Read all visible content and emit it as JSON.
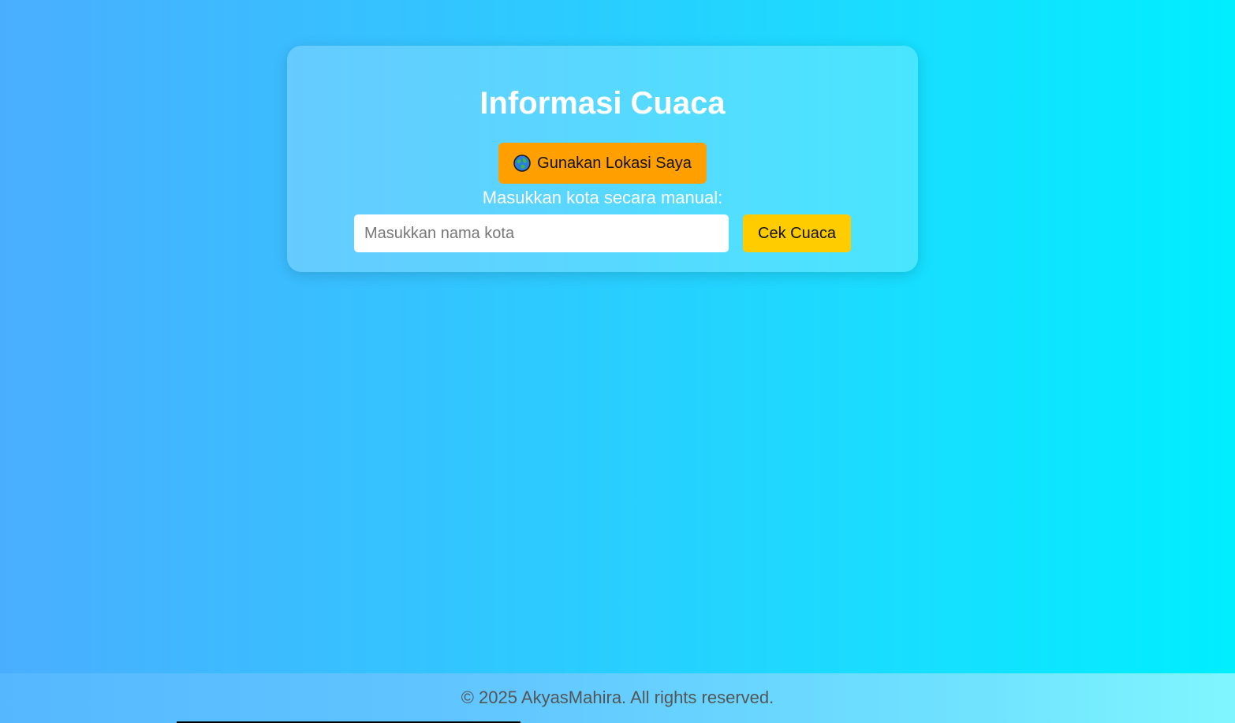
{
  "card": {
    "title": "Informasi Cuaca",
    "location_button": {
      "icon": "globe-icon",
      "label": "Gunakan Lokasi Saya"
    },
    "manual_label": "Masukkan kota secara manual:",
    "city_input": {
      "value": "",
      "placeholder": "Masukkan nama kota"
    },
    "check_button_label": "Cek Cuaca"
  },
  "footer": {
    "text": "© 2025 AkyasMahira. All rights reserved."
  },
  "colors": {
    "location_button": "#ff9f00",
    "check_button": "#ffcc00",
    "background_start": "#4aaeff",
    "background_end": "#00eeff"
  }
}
